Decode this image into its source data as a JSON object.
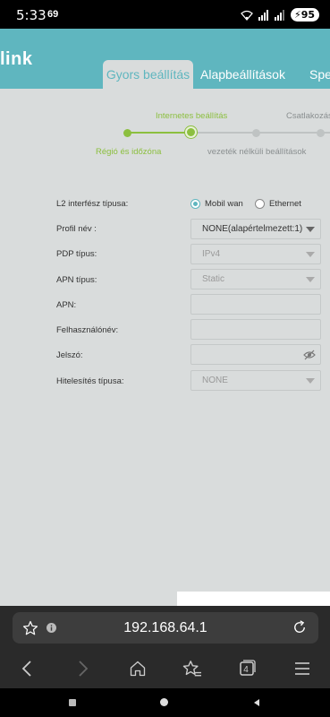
{
  "status_bar": {
    "time": "5:33",
    "notification": "69",
    "battery": "95"
  },
  "header": {
    "logo": "link",
    "tabs": [
      "Gyors beállítás",
      "Alapbeállítások",
      "Spec"
    ]
  },
  "stepper": {
    "top_labels": [
      "Internetes beállítás",
      "Csatlakozás"
    ],
    "bottom_labels": [
      "Régió és időzóna",
      "vezeték nélküli beállítások"
    ]
  },
  "form": {
    "l2_label": "L2 interfész típusa:",
    "l2_options": [
      "Mobil wan",
      "Ethernet"
    ],
    "profile_label": "Profil név :",
    "profile_value": "NONE(alapértelmezett:1)",
    "pdp_label": "PDP típus:",
    "pdp_value": "IPv4",
    "apn_type_label": "APN típus:",
    "apn_type_value": "Static",
    "apn_label": "APN:",
    "apn_value": "",
    "username_label": "Felhasználónév:",
    "username_value": "",
    "password_label": "Jelszó:",
    "password_value": "",
    "auth_label": "Hitelesítés típusa:",
    "auth_value": "NONE"
  },
  "browser": {
    "url": "192.168.64.1",
    "tab_count": "4"
  },
  "colors": {
    "accent": "#5fb6bf",
    "step_green": "#8cbf3f",
    "page_bg": "#d9dcdc"
  }
}
